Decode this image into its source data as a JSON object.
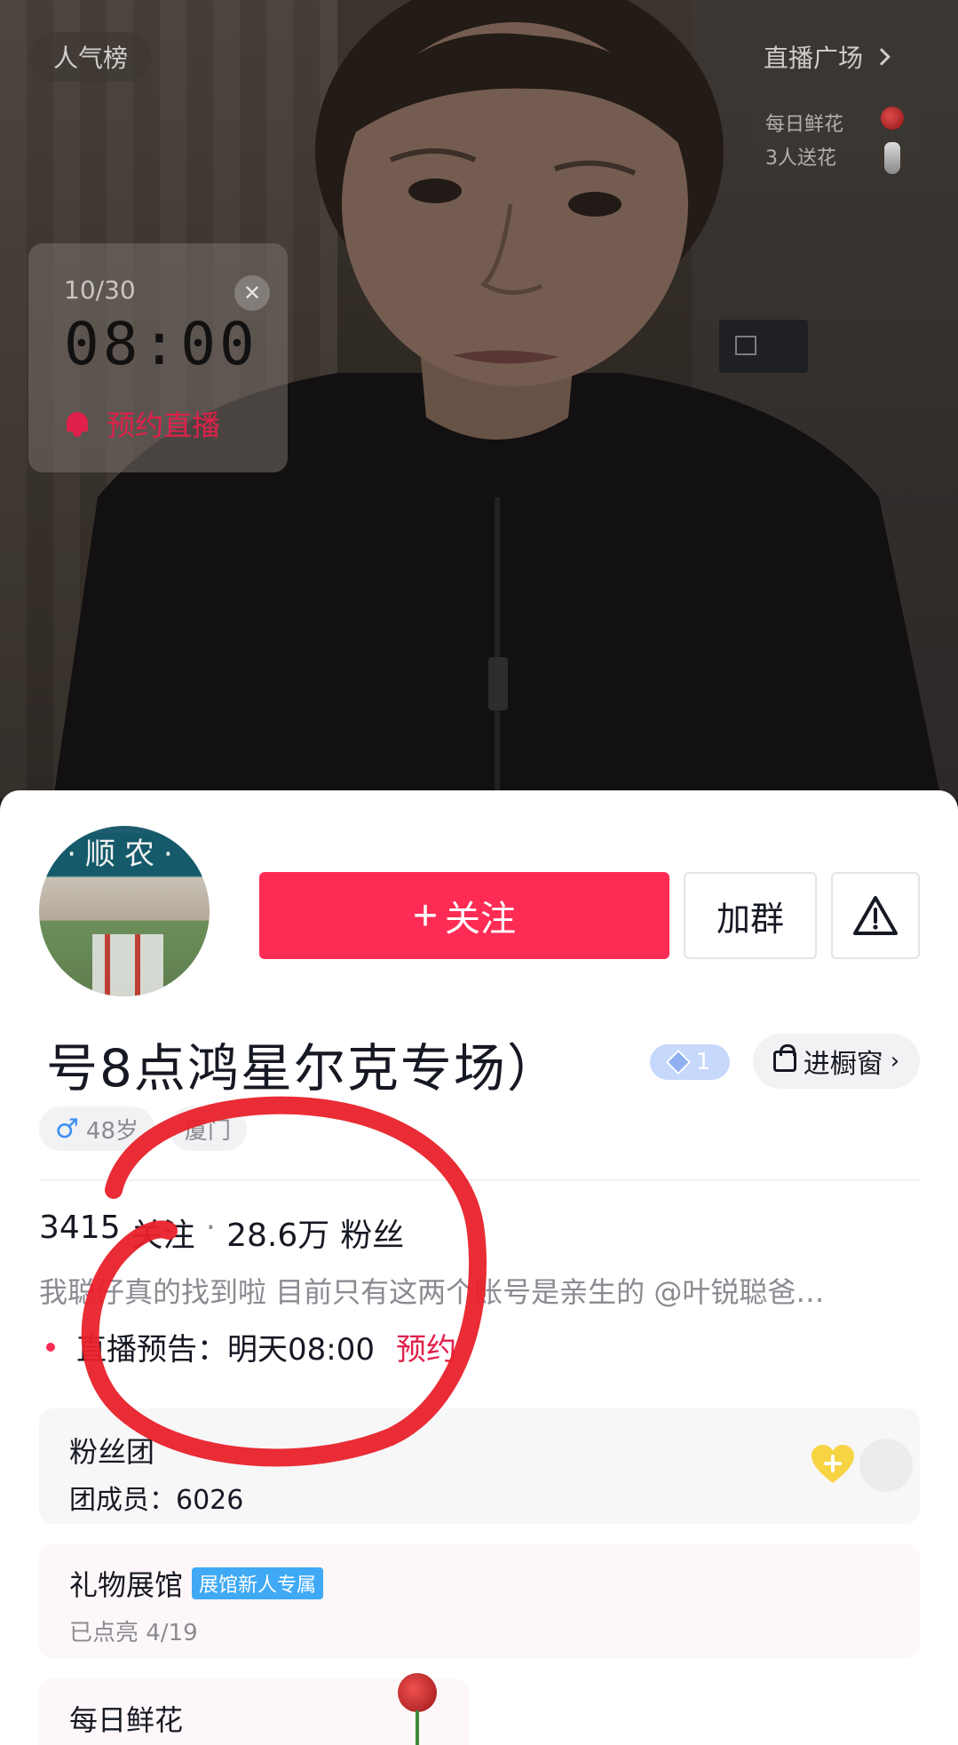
{
  "live_overlay": {
    "rank_label": "人气榜",
    "square_label": "直播广场",
    "flower_card": {
      "line1": "每日鲜花",
      "line2": "3人送花"
    },
    "schedule": {
      "date": "10/30",
      "time": "08:00",
      "reserve_label": "预约直播"
    }
  },
  "profile": {
    "follow_label": "关注",
    "group_label": "加群",
    "name": "号8点鸿星尔克专场）",
    "level": "1",
    "shop_label": "进橱窗",
    "tags": {
      "age": "48岁",
      "location": "厦门"
    },
    "stats": {
      "following": "3415",
      "following_label": "关注",
      "separator": "·",
      "fans": "28.6万",
      "fans_label": "粉丝"
    },
    "bio": "我聪仔真的找到啦 目前只有这两个账号是亲生的 @叶锐聪爸…",
    "preview": {
      "label": "直播预告：明天08:00",
      "link": "预约"
    },
    "fan_club": {
      "title": "粉丝团",
      "members": "团成员：6026"
    },
    "gift_hall": {
      "title": "礼物展馆",
      "badge": "展馆新人专属",
      "sub": "已点亮 4/19"
    },
    "daily_flower": {
      "title": "每日鲜花"
    }
  },
  "colors": {
    "accent": "#fe2c55",
    "link": "#e0204a",
    "badge_blue": "#3fa9f5"
  }
}
